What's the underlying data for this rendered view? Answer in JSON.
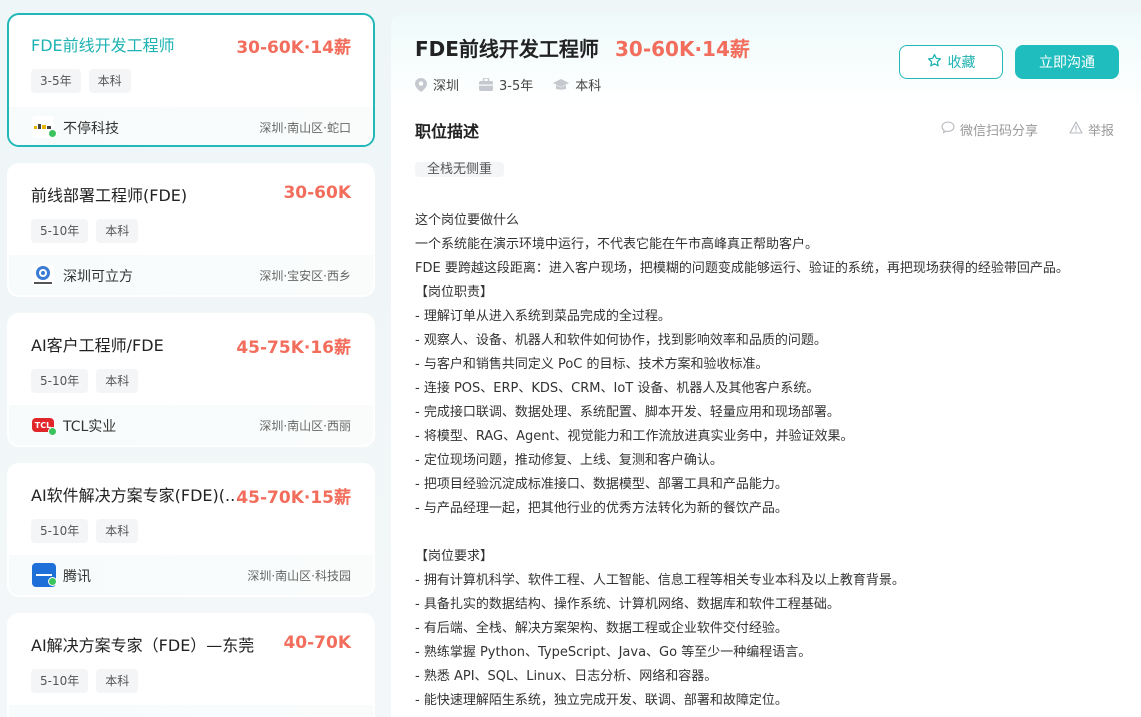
{
  "jobs": [
    {
      "title": "FDE前线开发工程师",
      "salary": "30-60K·14薪",
      "tags": [
        "3-5年",
        "本科"
      ],
      "company": "不停科技",
      "location": "深圳·南山区·蛇口",
      "logo_color": "#ffffff",
      "logo_text": "",
      "active": true
    },
    {
      "title": "前线部署工程师(FDE)",
      "salary": "30-60K",
      "tags": [
        "5-10年",
        "本科"
      ],
      "company": "深圳可立方",
      "location": "深圳·宝安区·西乡",
      "logo_color": "#ffffff",
      "logo_text": "",
      "active": false
    },
    {
      "title": "AI客户工程师/FDE",
      "salary": "45-75K·16薪",
      "tags": [
        "5-10年",
        "本科"
      ],
      "company": "TCL实业",
      "location": "深圳·南山区·西丽",
      "logo_color": "#e0262b",
      "logo_text": "TCL",
      "active": false
    },
    {
      "title": "AI软件解决方案专家(FDE)(...",
      "salary": "45-70K·15薪",
      "tags": [
        "5-10年",
        "本科"
      ],
      "company": "腾讯",
      "location": "深圳·南山区·科技园",
      "logo_color": "#1f6fd8",
      "logo_text": "",
      "active": false
    },
    {
      "title": "AI解决方案专家（FDE）—东莞",
      "salary": "40-70K",
      "tags": [
        "5-10年",
        "本科"
      ],
      "company": "",
      "location": "",
      "logo_color": "#ffffff",
      "logo_text": "",
      "active": false
    }
  ],
  "detail": {
    "title": "FDE前线开发工程师",
    "salary": "30-60K·14薪",
    "city": "深圳",
    "experience": "3-5年",
    "education": "本科",
    "fav_label": "收藏",
    "chat_label": "立即沟通",
    "section_title": "职位描述",
    "share_label": "微信扫码分享",
    "report_label": "举报",
    "tag": "全栈无侧重",
    "description": [
      "这个岗位要做什么",
      "一个系统能在演示环境中运行，不代表它能在午市高峰真正帮助客户。",
      "FDE 要跨越这段距离：进入客户现场，把模糊的问题变成能够运行、验证的系统，再把现场获得的经验带回产品。",
      "【岗位职责】",
      "- 理解订单从进入系统到菜品完成的全过程。",
      "- 观察人、设备、机器人和软件如何协作，找到影响效率和品质的问题。",
      "- 与客户和销售共同定义 PoC 的目标、技术方案和验收标准。",
      "- 连接 POS、ERP、KDS、CRM、IoT 设备、机器人及其他客户系统。",
      "- 完成接口联调、数据处理、系统配置、脚本开发、轻量应用和现场部署。",
      "- 将模型、RAG、Agent、视觉能力和工作流放进真实业务中，并验证效果。",
      "- 定位现场问题，推动修复、上线、复测和客户确认。",
      "- 把项目经验沉淀成标准接口、数据模型、部署工具和产品能力。",
      "- 与产品经理一起，把其他行业的优秀方法转化为新的餐饮产品。",
      "",
      "【岗位要求】",
      "- 拥有计算机科学、软件工程、人工智能、信息工程等相关专业本科及以上教育背景。",
      "- 具备扎实的数据结构、操作系统、计算机网络、数据库和软件工程基础。",
      "- 有后端、全栈、解决方案架构、数据工程或企业软件交付经验。",
      "- 熟练掌握 Python、TypeScript、Java、Go 等至少一种编程语言。",
      "- 熟悉 API、SQL、Linux、日志分析、网络和容器。",
      "- 能快速理解陌生系统，独立完成开发、联调、部署和故障定位。"
    ]
  },
  "colors": {
    "accent": "#1fb3b3",
    "salary": "#f26d5c",
    "online": "#3bc35d"
  }
}
